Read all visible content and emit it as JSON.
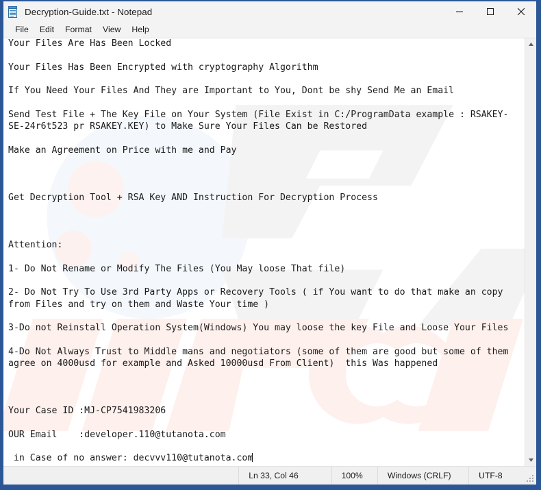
{
  "window": {
    "title": "Decryption-Guide.txt - Notepad",
    "app_icon": "notepad-icon",
    "accent_border_color": "#2b5797",
    "controls": {
      "minimize_label": "Minimize",
      "maximize_label": "Maximize",
      "close_label": "Close"
    }
  },
  "menubar": {
    "items": [
      {
        "label": "File"
      },
      {
        "label": "Edit"
      },
      {
        "label": "Format"
      },
      {
        "label": "View"
      },
      {
        "label": "Help"
      }
    ]
  },
  "editor": {
    "font": "monospace",
    "text_color": "#1a1a1a",
    "lines": [
      "Your Files Are Has Been Locked",
      "",
      "Your Files Has Been Encrypted with cryptography Algorithm",
      "",
      "If You Need Your Files And They are Important to You, Dont be shy Send Me an Email",
      "",
      "Send Test File + The Key File on Your System (File Exist in C:/ProgramData example : RSAKEY-",
      "SE-24r6t523 pr RSAKEY.KEY) to Make Sure Your Files Can be Restored",
      "",
      "Make an Agreement on Price with me and Pay",
      "",
      "",
      "",
      "Get Decryption Tool + RSA Key AND Instruction For Decryption Process",
      "",
      "",
      "",
      "Attention:",
      "",
      "1- Do Not Rename or Modify The Files (You May loose That file)",
      "",
      "2- Do Not Try To Use 3rd Party Apps or Recovery Tools ( if You want to do that make an copy",
      "from Files and try on them and Waste Your time )",
      "",
      "3-Do not Reinstall Operation System(Windows) You may loose the key File and Loose Your Files",
      "",
      "4-Do Not Always Trust to Middle mans and negotiators (some of them are good but some of them",
      "agree on 4000usd for example and Asked 10000usd From Client)  this Was happened",
      "",
      "",
      "",
      "Your Case ID :MJ-CP7541983206",
      "",
      "OUR Email    :developer.110@tutanota.com",
      "",
      " in Case of no answer: decvvv110@tutanota.com"
    ],
    "case_id": "MJ-CP7541983206",
    "primary_email": "developer.110@tutanota.com",
    "secondary_email": "decvvv110@tutanota.com",
    "watermark_text": "pcrisk.com"
  },
  "scrollbar": {
    "up_arrow": "scroll-up-arrow-icon",
    "down_arrow": "scroll-down-arrow-icon"
  },
  "statusbar": {
    "position": "Ln 33, Col 46",
    "zoom": "100%",
    "line_ending": "Windows (CRLF)",
    "encoding": "UTF-8"
  }
}
